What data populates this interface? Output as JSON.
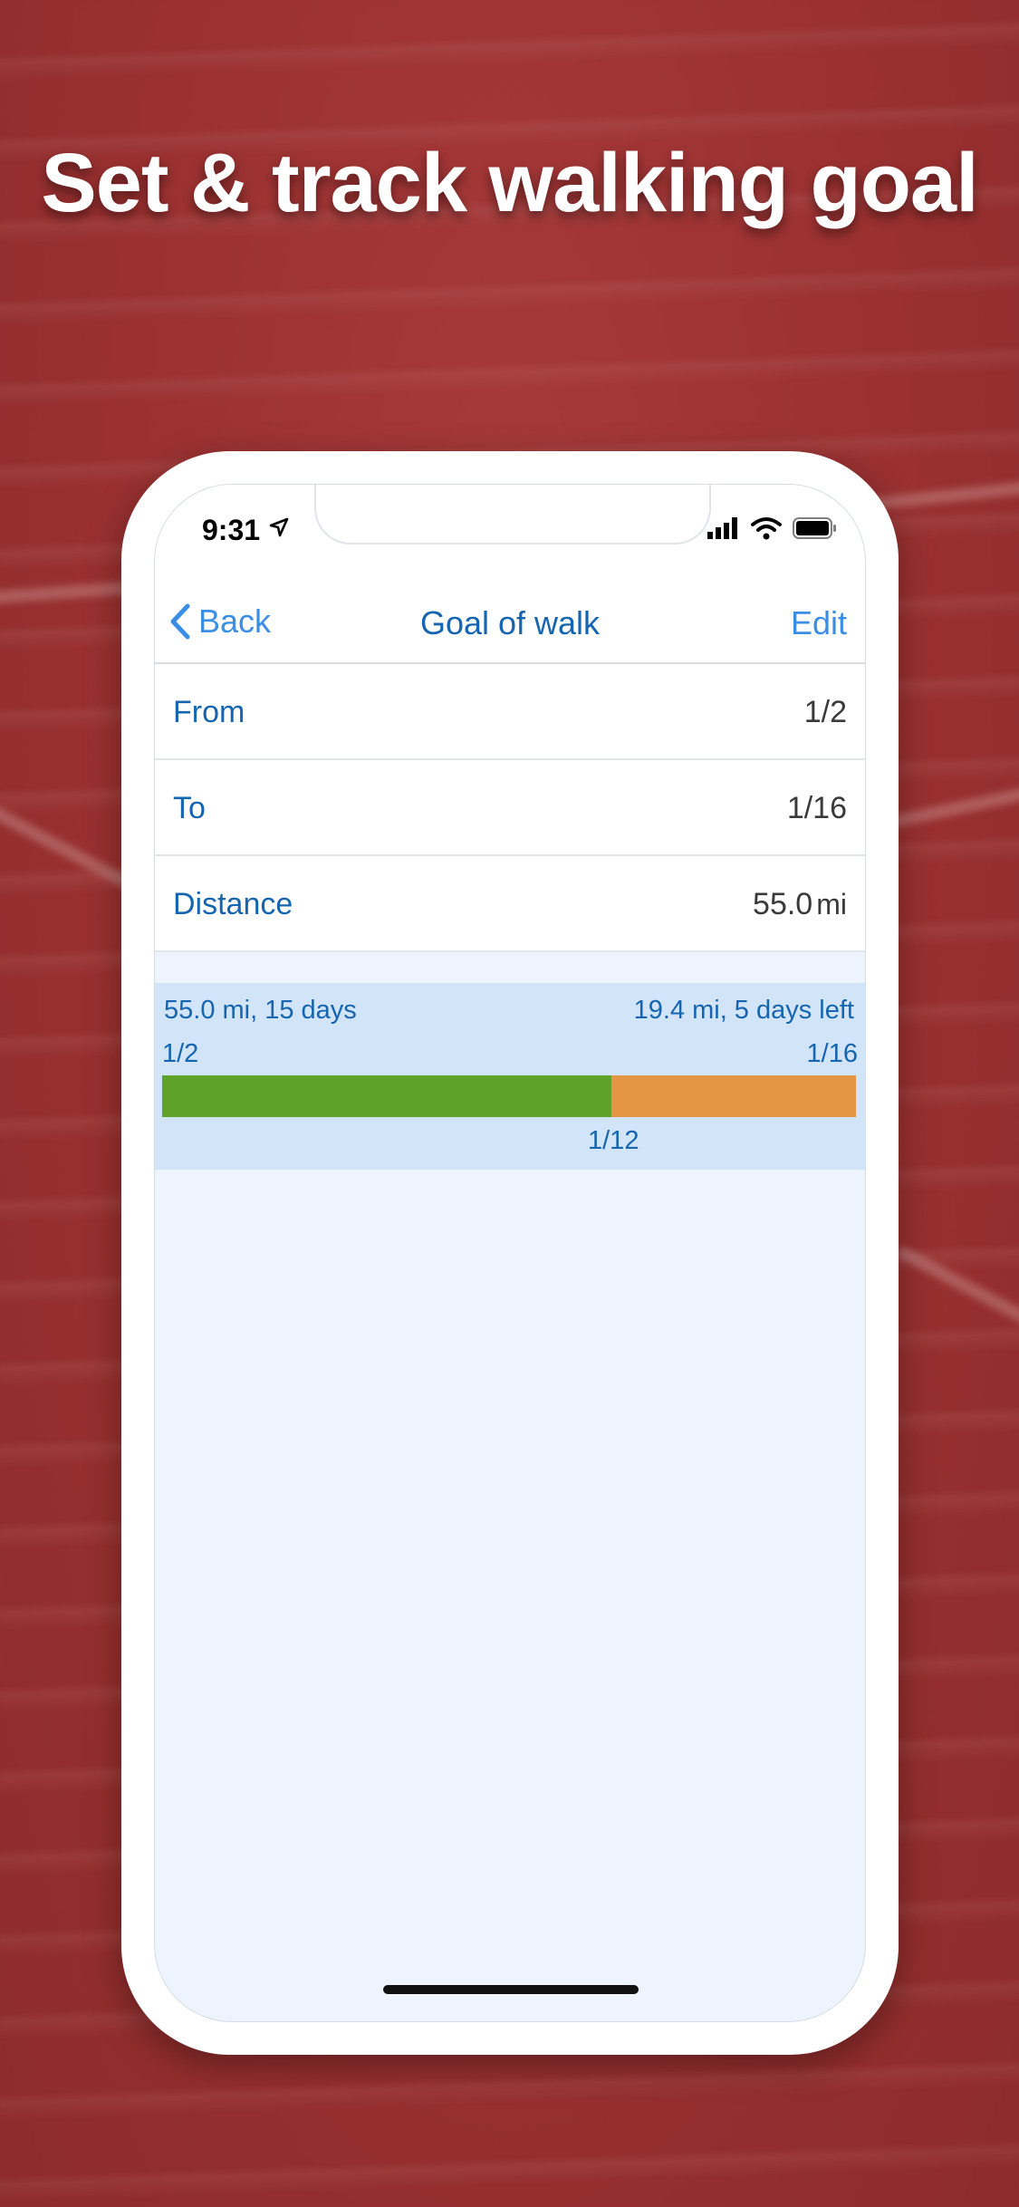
{
  "headline": "Set & track walking goal",
  "status_bar": {
    "time": "9:31"
  },
  "navbar": {
    "back_label": "Back",
    "title": "Goal of walk",
    "edit_label": "Edit"
  },
  "rows": [
    {
      "label": "From",
      "value": "1/2",
      "unit": ""
    },
    {
      "label": "To",
      "value": "1/16",
      "unit": ""
    },
    {
      "label": "Distance",
      "value": "55.0",
      "unit": "mi"
    }
  ],
  "progress": {
    "goal_summary": "55.0 mi, 15 days",
    "remaining_summary": "19.4 mi, 5 days left",
    "start_date": "1/2",
    "end_date": "1/16",
    "current_date": "1/12",
    "completed_fraction": 0.648,
    "colors": {
      "done": "#5ea22a",
      "remaining": "#e59546"
    }
  },
  "colors": {
    "accent": "#3a8ee6",
    "title": "#1565b0",
    "background": "#9a3030"
  }
}
